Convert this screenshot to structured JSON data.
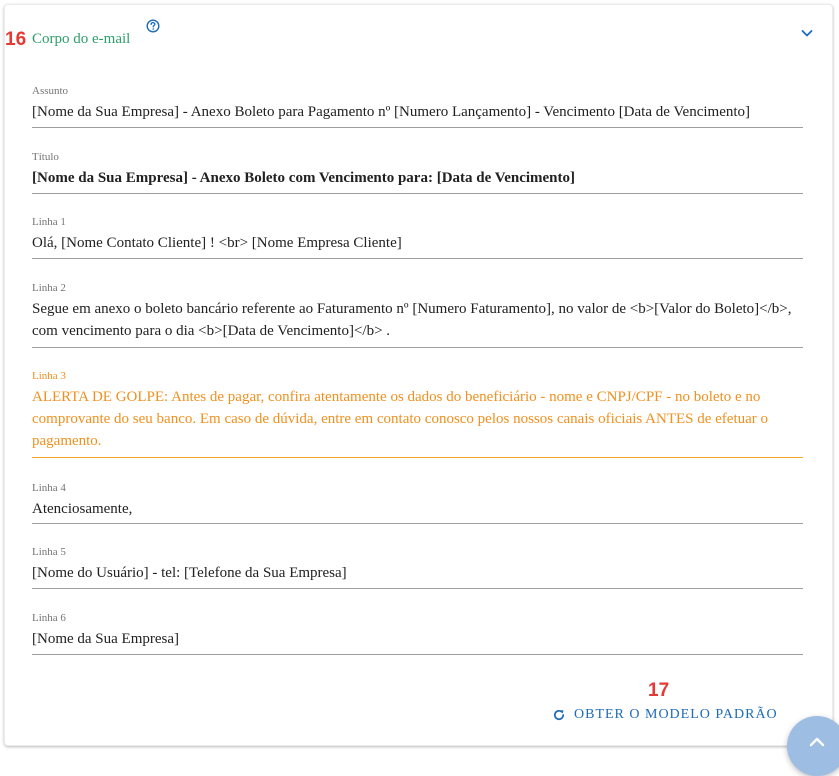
{
  "annotations": {
    "step_16": "16",
    "step_17": "17"
  },
  "section": {
    "title": "Corpo do e-mail",
    "help_icon": "help-circle-icon",
    "collapse_icon": "chevron-down-icon"
  },
  "fields": {
    "assunto": {
      "label": "Assunto",
      "value": "[Nome da Sua Empresa] - Anexo Boleto para Pagamento nº [Numero Lançamento] - Vencimento [Data de Vencimento]"
    },
    "titulo": {
      "label": "Título",
      "value": "[Nome da Sua Empresa] - Anexo Boleto com Vencimento para: [Data de Vencimento]"
    },
    "linha1": {
      "label": "Linha 1",
      "value": "Olá, [Nome Contato Cliente] ! <br> [Nome Empresa Cliente]"
    },
    "linha2": {
      "label": "Linha 2",
      "value": "Segue em anexo o boleto bancário referente ao Faturamento nº [Numero Faturamento], no valor de <b>[Valor do Boleto]</b>, com vencimento para o dia <b>[Data de Vencimento]</b> ."
    },
    "linha3": {
      "label": "Linha 3",
      "value": "ALERTA DE GOLPE: Antes de pagar, confira atentamente os dados do beneficiário - nome e CNPJ/CPF - no boleto e no comprovante do seu banco. Em caso de dúvida, entre em contato conosco pelos nossos canais oficiais ANTES de efetuar o pagamento."
    },
    "linha4": {
      "label": "Linha 4",
      "value": "Atenciosamente,"
    },
    "linha5": {
      "label": "Linha 5",
      "value": "[Nome do Usuário] - tel: [Telefone da Sua Empresa]"
    },
    "linha6": {
      "label": "Linha 6",
      "value": "[Nome da Sua Empresa]"
    }
  },
  "actions": {
    "reset_label": "OBTER O MODELO PADRÃO",
    "reset_icon": "refresh-icon",
    "scroll_top_icon": "chevron-up-icon"
  },
  "colors": {
    "title_green": "#2e9e6b",
    "warning_orange": "#f0901e",
    "link_blue": "#1e6bb8",
    "annotation_red": "#e53935",
    "fab_blue": "#9dbde3"
  }
}
